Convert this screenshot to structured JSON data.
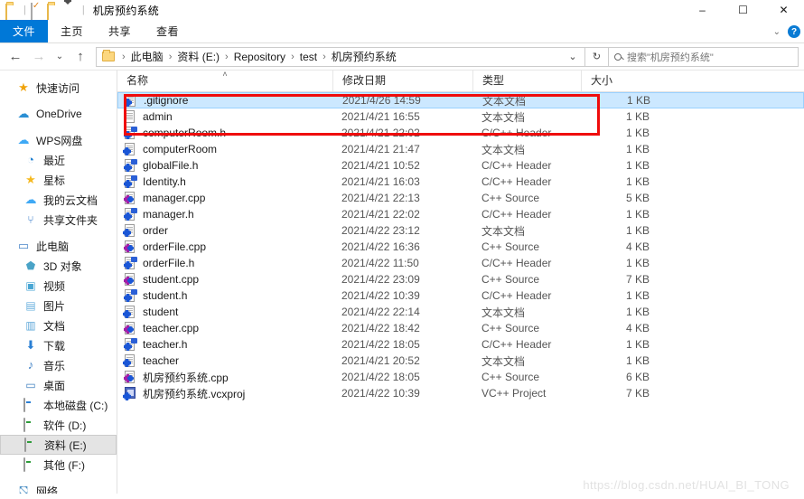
{
  "window": {
    "title": "机房预约系统",
    "quick_access": [
      {
        "name": "folder-icon",
        "label": "新建文件夹"
      },
      {
        "name": "properties-icon",
        "label": "属性"
      },
      {
        "name": "folder-icon-2",
        "label": "新建文件夹"
      },
      {
        "name": "customize-dropdown-icon",
        "label": "自定义快速访问工具栏"
      }
    ],
    "controls": {
      "minimize": "–",
      "maximize": "☐",
      "close": "✕"
    }
  },
  "ribbon": {
    "tabs": [
      {
        "label": "文件",
        "active": true
      },
      {
        "label": "主页",
        "active": false
      },
      {
        "label": "共享",
        "active": false
      },
      {
        "label": "查看",
        "active": false
      }
    ],
    "expand_label": "⌄",
    "help_label": "?"
  },
  "address": {
    "back": "←",
    "forward": "→",
    "recent": "⌄",
    "up": "↑",
    "crumbs": [
      "此电脑",
      "资料 (E:)",
      "Repository",
      "test",
      "机房预约系统"
    ],
    "separator": "›",
    "dropdown": "⌄",
    "refresh": "↻"
  },
  "search": {
    "placeholder": "搜索\"机房预约系统\"",
    "value": ""
  },
  "sidebar": {
    "groups": [
      {
        "items": [
          {
            "label": "快速访问",
            "icon": "pin-star-icon",
            "icon_class": "ico-star",
            "glyph": "★",
            "indent": 0,
            "selected": false
          }
        ]
      },
      {
        "items": [
          {
            "label": "OneDrive",
            "icon": "onedrive-cloud-icon",
            "icon_class": "ico-cloud",
            "glyph": "☁",
            "indent": 0,
            "selected": false
          }
        ]
      },
      {
        "items": [
          {
            "label": "WPS网盘",
            "icon": "wps-cloud-icon",
            "icon_class": "ico-cloud2",
            "glyph": "☁",
            "indent": 0,
            "selected": false
          },
          {
            "label": "最近",
            "icon": "recent-clock-icon",
            "icon_class": "ico-clock",
            "glyph": "◔",
            "indent": 1,
            "selected": false
          },
          {
            "label": "星标",
            "icon": "starred-icon",
            "icon_class": "ico-star2",
            "glyph": "★",
            "indent": 1,
            "selected": false
          },
          {
            "label": "我的云文档",
            "icon": "my-cloud-docs-icon",
            "icon_class": "ico-cloud2",
            "glyph": "☁",
            "indent": 1,
            "selected": false
          },
          {
            "label": "共享文件夹",
            "icon": "shared-folder-icon",
            "icon_class": "ico-share",
            "glyph": "⑂",
            "indent": 1,
            "selected": false
          }
        ]
      },
      {
        "items": [
          {
            "label": "此电脑",
            "icon": "this-pc-icon",
            "icon_class": "ico-pc",
            "glyph": "▭",
            "indent": 0,
            "selected": false
          },
          {
            "label": "3D 对象",
            "icon": "3d-objects-icon",
            "icon_class": "ico-3d",
            "glyph": "⬟",
            "indent": 1,
            "selected": false
          },
          {
            "label": "视频",
            "icon": "videos-icon",
            "icon_class": "ico-video",
            "glyph": "▣",
            "indent": 1,
            "selected": false
          },
          {
            "label": "图片",
            "icon": "pictures-icon",
            "icon_class": "ico-pic",
            "glyph": "▤",
            "indent": 1,
            "selected": false
          },
          {
            "label": "文档",
            "icon": "documents-icon",
            "icon_class": "ico-docs",
            "glyph": "▥",
            "indent": 1,
            "selected": false
          },
          {
            "label": "下载",
            "icon": "downloads-icon",
            "icon_class": "ico-dl",
            "glyph": "⬇",
            "indent": 1,
            "selected": false
          },
          {
            "label": "音乐",
            "icon": "music-icon",
            "icon_class": "ico-music",
            "glyph": "♪",
            "indent": 1,
            "selected": false
          },
          {
            "label": "桌面",
            "icon": "desktop-icon",
            "icon_class": "ico-desktop",
            "glyph": "▭",
            "indent": 1,
            "selected": false
          },
          {
            "label": "本地磁盘 (C:)",
            "icon": "drive-c-icon",
            "icon_class": "drive-sys",
            "glyph": "",
            "indent": 1,
            "selected": false
          },
          {
            "label": "软件 (D:)",
            "icon": "drive-d-icon",
            "icon_class": "drive",
            "glyph": "",
            "indent": 1,
            "selected": false
          },
          {
            "label": "资料 (E:)",
            "icon": "drive-e-icon",
            "icon_class": "drive",
            "glyph": "",
            "indent": 1,
            "selected": true
          },
          {
            "label": "其他 (F:)",
            "icon": "drive-f-icon",
            "icon_class": "drive",
            "glyph": "",
            "indent": 1,
            "selected": false
          }
        ]
      },
      {
        "items": [
          {
            "label": "网络",
            "icon": "network-icon",
            "icon_class": "net-glyph",
            "glyph": "⛞",
            "indent": 0,
            "selected": false
          }
        ]
      }
    ]
  },
  "filelist": {
    "columns": [
      {
        "label": "名称",
        "key": "name",
        "sorted": true
      },
      {
        "label": "修改日期",
        "key": "date",
        "sorted": false
      },
      {
        "label": "类型",
        "key": "type",
        "sorted": false
      },
      {
        "label": "大小",
        "key": "size",
        "sorted": false
      }
    ],
    "sort_indicator": "˄",
    "rows": [
      {
        "name": ".gitignore",
        "date": "2021/4/26 14:59",
        "type": "文本文档",
        "size": "1 KB",
        "icon": "vs-text-file-icon",
        "selected": true
      },
      {
        "name": "admin",
        "date": "2021/4/21 16:55",
        "type": "文本文档",
        "size": "1 KB",
        "icon": "text-file-icon",
        "selected": false
      },
      {
        "name": "computerRoom.h",
        "date": "2021/4/21 22:02",
        "type": "C/C++ Header",
        "size": "1 KB",
        "icon": "cpp-header-icon",
        "selected": false
      },
      {
        "name": "computerRoom",
        "date": "2021/4/21 21:47",
        "type": "文本文档",
        "size": "1 KB",
        "icon": "vs-text-file-icon",
        "selected": false
      },
      {
        "name": "globalFile.h",
        "date": "2021/4/21 10:52",
        "type": "C/C++ Header",
        "size": "1 KB",
        "icon": "cpp-header-icon",
        "selected": false
      },
      {
        "name": "Identity.h",
        "date": "2021/4/21 16:03",
        "type": "C/C++ Header",
        "size": "1 KB",
        "icon": "cpp-header-icon",
        "selected": false
      },
      {
        "name": "manager.cpp",
        "date": "2021/4/21 22:13",
        "type": "C++ Source",
        "size": "5 KB",
        "icon": "cpp-source-icon",
        "selected": false
      },
      {
        "name": "manager.h",
        "date": "2021/4/21 22:02",
        "type": "C/C++ Header",
        "size": "1 KB",
        "icon": "cpp-header-icon",
        "selected": false
      },
      {
        "name": "order",
        "date": "2021/4/22 23:12",
        "type": "文本文档",
        "size": "1 KB",
        "icon": "vs-text-file-icon",
        "selected": false
      },
      {
        "name": "orderFile.cpp",
        "date": "2021/4/22 16:36",
        "type": "C++ Source",
        "size": "4 KB",
        "icon": "cpp-source-icon",
        "selected": false
      },
      {
        "name": "orderFile.h",
        "date": "2021/4/22 11:50",
        "type": "C/C++ Header",
        "size": "1 KB",
        "icon": "cpp-header-icon",
        "selected": false
      },
      {
        "name": "student.cpp",
        "date": "2021/4/22 23:09",
        "type": "C++ Source",
        "size": "7 KB",
        "icon": "cpp-source-icon",
        "selected": false
      },
      {
        "name": "student.h",
        "date": "2021/4/22 10:39",
        "type": "C/C++ Header",
        "size": "1 KB",
        "icon": "cpp-header-icon",
        "selected": false
      },
      {
        "name": "student",
        "date": "2021/4/22 22:14",
        "type": "文本文档",
        "size": "1 KB",
        "icon": "vs-text-file-icon",
        "selected": false
      },
      {
        "name": "teacher.cpp",
        "date": "2021/4/22 18:42",
        "type": "C++ Source",
        "size": "4 KB",
        "icon": "cpp-source-icon",
        "selected": false
      },
      {
        "name": "teacher.h",
        "date": "2021/4/22 18:05",
        "type": "C/C++ Header",
        "size": "1 KB",
        "icon": "cpp-header-icon",
        "selected": false
      },
      {
        "name": "teacher",
        "date": "2021/4/21 20:52",
        "type": "文本文档",
        "size": "1 KB",
        "icon": "vs-text-file-icon",
        "selected": false
      },
      {
        "name": "机房预约系统.cpp",
        "date": "2021/4/22 18:05",
        "type": "C++ Source",
        "size": "6 KB",
        "icon": "cpp-source-icon",
        "selected": false
      },
      {
        "name": "机房预约系统.vcxproj",
        "date": "2021/4/22 10:39",
        "type": "VC++ Project",
        "size": "7 KB",
        "icon": "vcxproj-icon",
        "selected": false
      }
    ]
  },
  "annotation": {
    "type": "red-rectangle-highlight",
    "covers": [
      ".gitignore",
      "admin"
    ]
  },
  "watermark": {
    "text": "https://blog.csdn.net/HUAI_BI_TONG"
  },
  "colors": {
    "accent": "#0078d7",
    "selection": "#cce8ff",
    "annotation": "#ef0c0c",
    "folder": "#fcd77f"
  }
}
